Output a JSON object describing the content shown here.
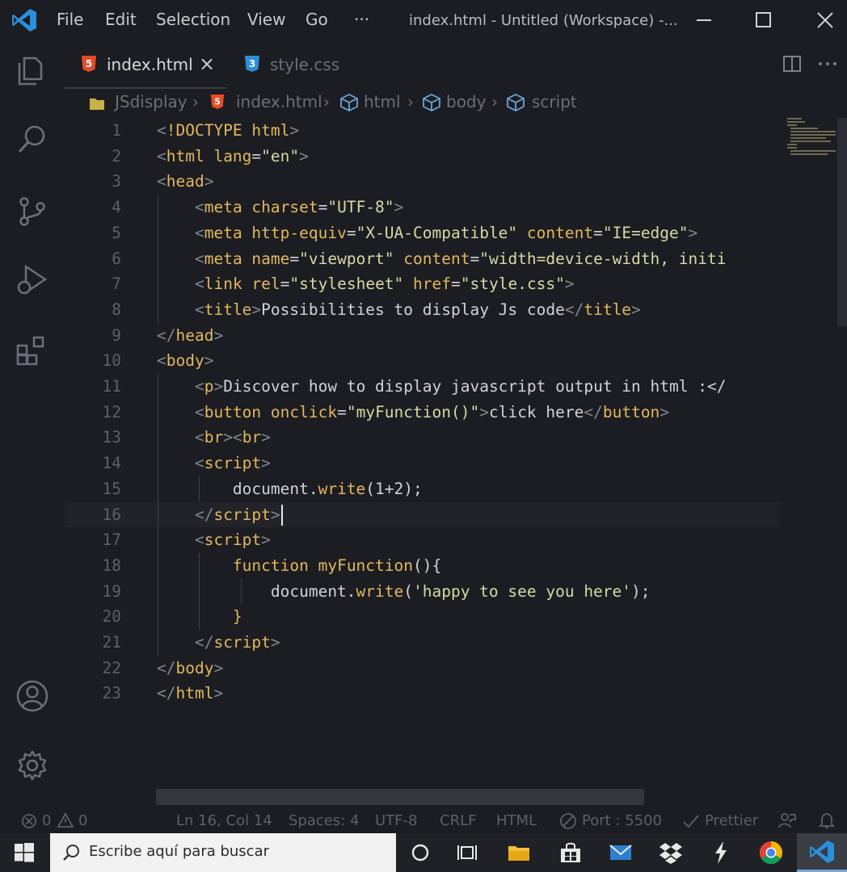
{
  "titlebar": {
    "menu": [
      "File",
      "Edit",
      "Selection",
      "View",
      "Go",
      "···"
    ],
    "window_title": "index.html - Untitled (Workspace) -..."
  },
  "tabs": [
    {
      "label": "index.html",
      "icon": "html5-icon",
      "active": true,
      "close": "×"
    },
    {
      "label": "style.css",
      "icon": "css3-icon",
      "active": false
    }
  ],
  "breadcrumb": [
    "JSdisplay",
    "index.html",
    "html",
    "body",
    "script"
  ],
  "breadcrumb_sep": "›",
  "editor": {
    "cursor_line": 16,
    "lines": [
      {
        "n": "1",
        "tokens": [
          [
            "tag",
            "<"
          ],
          [
            "el",
            "!DOCTYPE html"
          ],
          [
            "tag",
            ">"
          ]
        ]
      },
      {
        "n": "2",
        "tokens": [
          [
            "tag",
            "<"
          ],
          [
            "el",
            "html "
          ],
          [
            "attr",
            "lang"
          ],
          [
            "plain",
            "="
          ],
          [
            "str",
            "\"en\""
          ],
          [
            "tag",
            ">"
          ]
        ]
      },
      {
        "n": "3",
        "tokens": [
          [
            "tag",
            "<"
          ],
          [
            "el",
            "head"
          ],
          [
            "tag",
            ">"
          ]
        ]
      },
      {
        "n": "4",
        "tokens": [
          [
            "plain",
            "    "
          ],
          [
            "tag",
            "<"
          ],
          [
            "el",
            "meta "
          ],
          [
            "attr",
            "charset"
          ],
          [
            "plain",
            "="
          ],
          [
            "str",
            "\"UTF-8\""
          ],
          [
            "tag",
            ">"
          ]
        ]
      },
      {
        "n": "5",
        "tokens": [
          [
            "plain",
            "    "
          ],
          [
            "tag",
            "<"
          ],
          [
            "el",
            "meta "
          ],
          [
            "attr",
            "http-equiv"
          ],
          [
            "plain",
            "="
          ],
          [
            "str",
            "\"X-UA-Compatible\""
          ],
          [
            "plain",
            " "
          ],
          [
            "attr",
            "content"
          ],
          [
            "plain",
            "="
          ],
          [
            "str",
            "\"IE=edge\""
          ],
          [
            "tag",
            ">"
          ]
        ]
      },
      {
        "n": "6",
        "tokens": [
          [
            "plain",
            "    "
          ],
          [
            "tag",
            "<"
          ],
          [
            "el",
            "meta "
          ],
          [
            "attr",
            "name"
          ],
          [
            "plain",
            "="
          ],
          [
            "str",
            "\"viewport\""
          ],
          [
            "plain",
            " "
          ],
          [
            "attr",
            "content"
          ],
          [
            "plain",
            "="
          ],
          [
            "str",
            "\"width=device-width, initi"
          ]
        ]
      },
      {
        "n": "7",
        "tokens": [
          [
            "plain",
            "    "
          ],
          [
            "tag",
            "<"
          ],
          [
            "el",
            "link "
          ],
          [
            "attr",
            "rel"
          ],
          [
            "plain",
            "="
          ],
          [
            "str",
            "\"stylesheet\""
          ],
          [
            "plain",
            " "
          ],
          [
            "attr",
            "href"
          ],
          [
            "plain",
            "="
          ],
          [
            "str",
            "\"style.css\""
          ],
          [
            "tag",
            ">"
          ]
        ]
      },
      {
        "n": "8",
        "tokens": [
          [
            "plain",
            "    "
          ],
          [
            "tag",
            "<"
          ],
          [
            "el",
            "title"
          ],
          [
            "tag",
            ">"
          ],
          [
            "text",
            "Possibilities to display Js code"
          ],
          [
            "tag",
            "</"
          ],
          [
            "el",
            "title"
          ],
          [
            "tag",
            ">"
          ]
        ]
      },
      {
        "n": "9",
        "tokens": [
          [
            "tag",
            "</"
          ],
          [
            "el",
            "head"
          ],
          [
            "tag",
            ">"
          ]
        ]
      },
      {
        "n": "10",
        "tokens": [
          [
            "tag",
            "<"
          ],
          [
            "el",
            "body"
          ],
          [
            "tag",
            ">"
          ]
        ]
      },
      {
        "n": "11",
        "tokens": [
          [
            "plain",
            "    "
          ],
          [
            "tag",
            "<"
          ],
          [
            "el",
            "p"
          ],
          [
            "tag",
            ">"
          ],
          [
            "text",
            "Discover how to display javascript output in html :</"
          ]
        ]
      },
      {
        "n": "12",
        "tokens": [
          [
            "plain",
            "    "
          ],
          [
            "tag",
            "<"
          ],
          [
            "el",
            "button "
          ],
          [
            "attr",
            "onclick"
          ],
          [
            "plain",
            "="
          ],
          [
            "str",
            "\"myFunction()\""
          ],
          [
            "tag",
            ">"
          ],
          [
            "text",
            "click here"
          ],
          [
            "tag",
            "</"
          ],
          [
            "el",
            "button"
          ],
          [
            "tag",
            ">"
          ]
        ]
      },
      {
        "n": "13",
        "tokens": [
          [
            "plain",
            "    "
          ],
          [
            "tag",
            "<"
          ],
          [
            "el",
            "br"
          ],
          [
            "tag",
            "><"
          ],
          [
            "el",
            "br"
          ],
          [
            "tag",
            ">"
          ]
        ]
      },
      {
        "n": "14",
        "tokens": [
          [
            "plain",
            "    "
          ],
          [
            "tag",
            "<"
          ],
          [
            "el",
            "script"
          ],
          [
            "tag",
            ">"
          ]
        ]
      },
      {
        "n": "15",
        "tokens": [
          [
            "plain",
            "        document."
          ],
          [
            "fn",
            "write"
          ],
          [
            "plain",
            "(1+2);"
          ]
        ]
      },
      {
        "n": "16",
        "tokens": [
          [
            "plain",
            "    "
          ],
          [
            "tag",
            "</"
          ],
          [
            "el",
            "script"
          ],
          [
            "tag",
            ">"
          ]
        ]
      },
      {
        "n": "17",
        "tokens": [
          [
            "plain",
            "    "
          ],
          [
            "tag",
            "<"
          ],
          [
            "el",
            "script"
          ],
          [
            "tag",
            ">"
          ]
        ]
      },
      {
        "n": "18",
        "tokens": [
          [
            "plain",
            "        "
          ],
          [
            "kw",
            "function "
          ],
          [
            "fn",
            "myFunction"
          ],
          [
            "plain",
            "(){"
          ]
        ]
      },
      {
        "n": "19",
        "tokens": [
          [
            "plain",
            "            document."
          ],
          [
            "fn",
            "write"
          ],
          [
            "plain",
            "("
          ],
          [
            "str",
            "'happy to see you here'"
          ],
          [
            "plain",
            ");"
          ]
        ]
      },
      {
        "n": "20",
        "tokens": [
          [
            "plain",
            "        "
          ],
          [
            "fn",
            "}"
          ]
        ]
      },
      {
        "n": "21",
        "tokens": [
          [
            "plain",
            "    "
          ],
          [
            "tag",
            "</"
          ],
          [
            "el",
            "script"
          ],
          [
            "tag",
            ">"
          ]
        ]
      },
      {
        "n": "22",
        "tokens": [
          [
            "tag",
            "</"
          ],
          [
            "el",
            "body"
          ],
          [
            "tag",
            ">"
          ]
        ]
      },
      {
        "n": "23",
        "tokens": [
          [
            "tag",
            "</"
          ],
          [
            "el",
            "html"
          ],
          [
            "tag",
            ">"
          ]
        ]
      }
    ]
  },
  "statusbar": {
    "errors": "0",
    "warnings": "0",
    "position": "Ln 16, Col 14",
    "spaces": "Spaces: 4",
    "encoding": "UTF-8",
    "eol": "CRLF",
    "language": "HTML",
    "port": "Port : 5500",
    "prettier": "Prettier"
  },
  "taskbar": {
    "search_placeholder": "Escribe aquí para buscar"
  },
  "colors": {
    "background": "#1b1d22",
    "accent": "#0e639c",
    "tag_name": "#e4b75b",
    "string": "#d7d9a3"
  }
}
